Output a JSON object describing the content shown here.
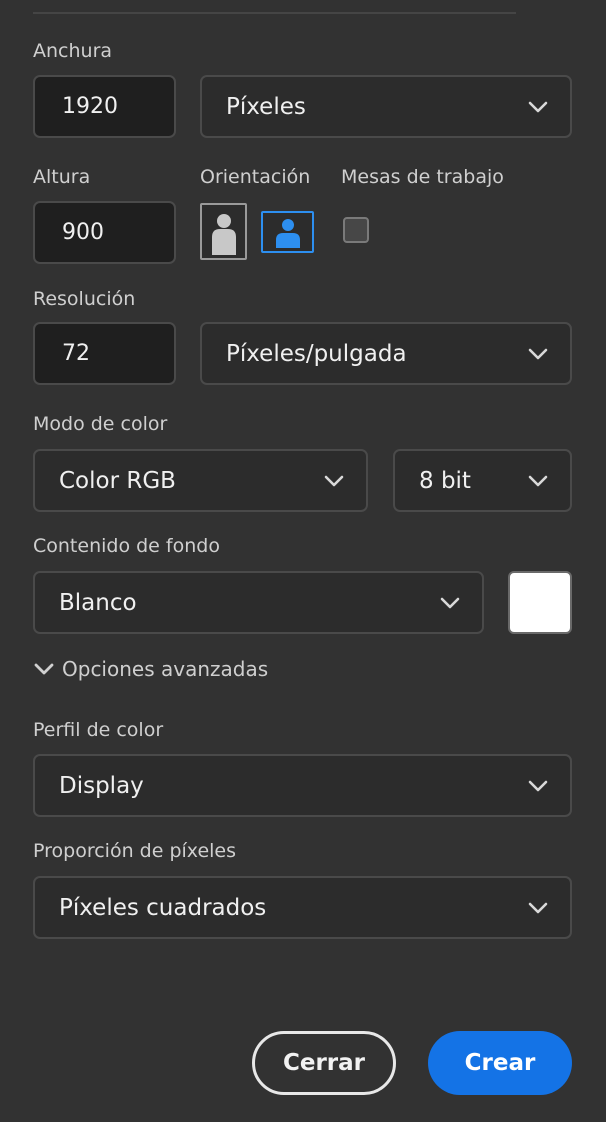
{
  "width": {
    "label": "Anchura",
    "value": "1920",
    "unit": "Píxeles"
  },
  "height": {
    "label": "Altura",
    "value": "900"
  },
  "orientation": {
    "label": "Orientación",
    "selected": "landscape"
  },
  "artboards": {
    "label": "Mesas de trabajo",
    "checked": false
  },
  "resolution": {
    "label": "Resolución",
    "value": "72",
    "unit": "Píxeles/pulgada"
  },
  "color_mode": {
    "label": "Modo de color",
    "mode": "Color RGB",
    "depth": "8 bit"
  },
  "background": {
    "label": "Contenido de fondo",
    "value": "Blanco",
    "swatch_color": "#ffffff"
  },
  "advanced": {
    "label": "Opciones avanzadas"
  },
  "color_profile": {
    "label": "Perfil de color",
    "value": "Display"
  },
  "pixel_aspect": {
    "label": "Proporción de píxeles",
    "value": "Píxeles cuadrados"
  },
  "actions": {
    "close": "Cerrar",
    "create": "Crear"
  },
  "colors": {
    "accent": "#1473e6",
    "orientation_selected": "#2d8ff0",
    "panel": "#323232"
  }
}
